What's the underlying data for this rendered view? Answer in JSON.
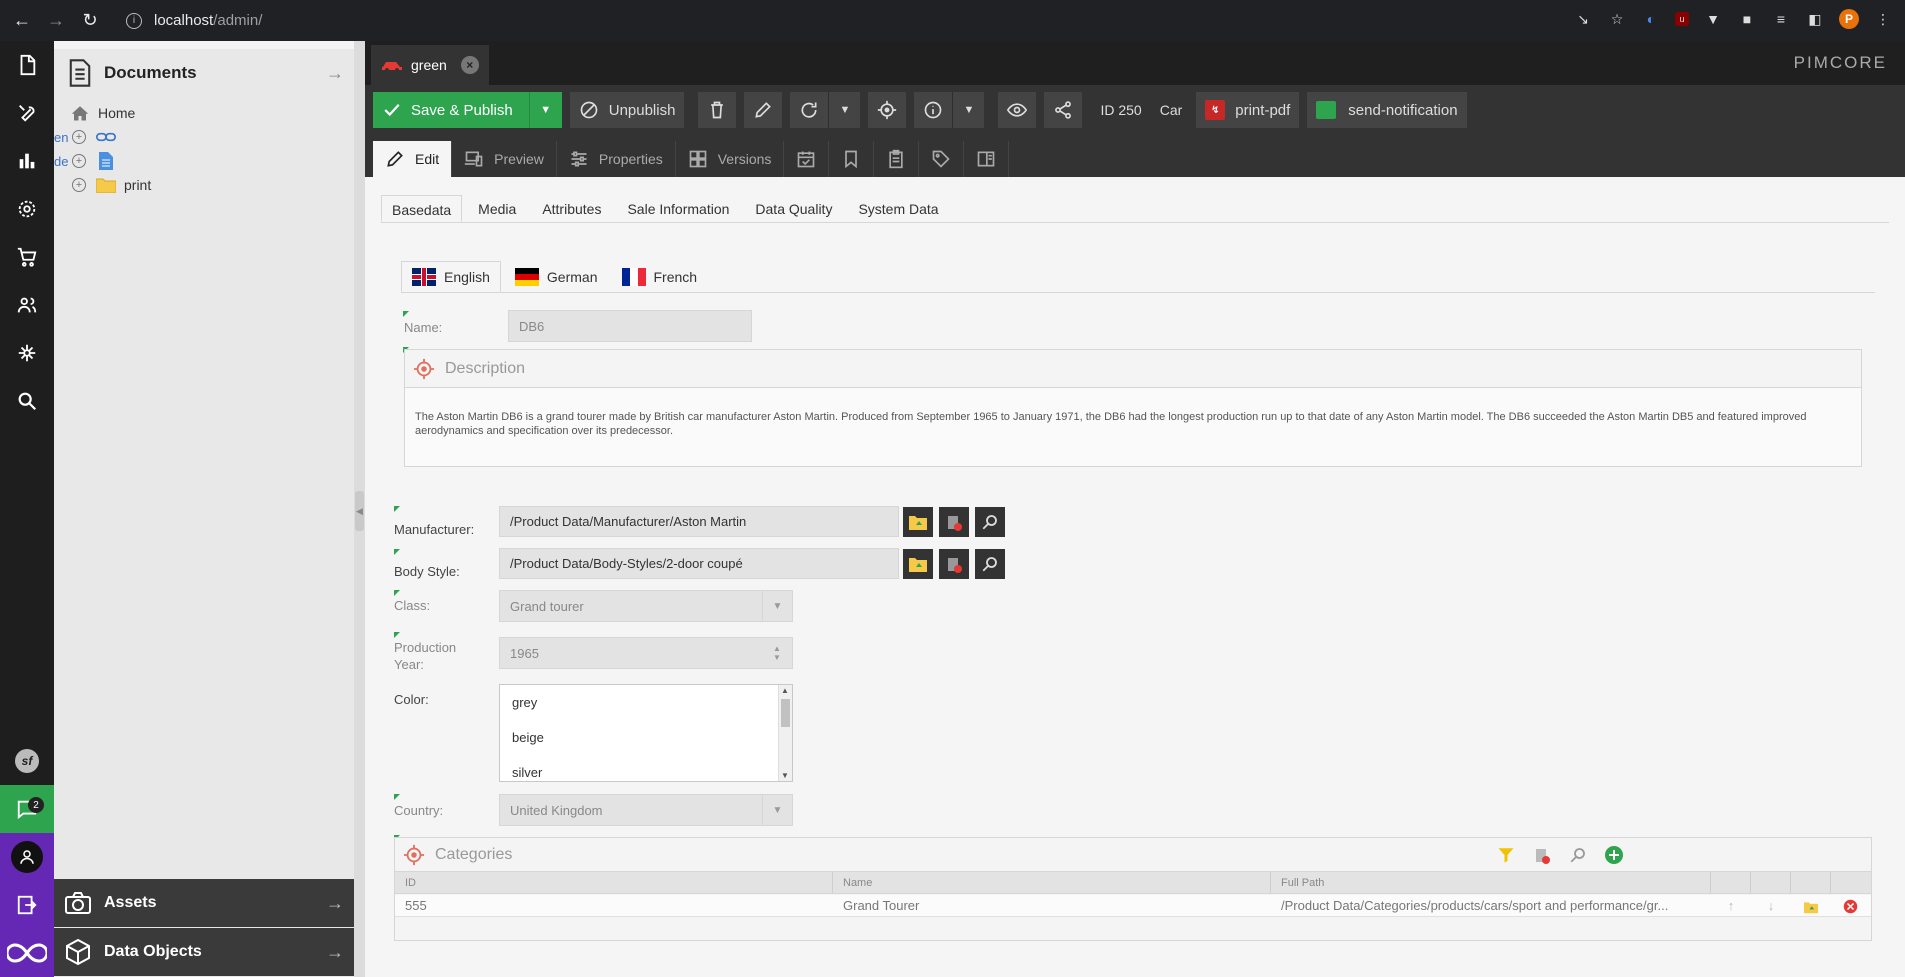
{
  "browser": {
    "url_host": "localhost",
    "url_path": "/admin/",
    "profile_initial": "P"
  },
  "tree": {
    "title": "Documents",
    "items": [
      {
        "label": "Home"
      },
      {
        "label": "en"
      },
      {
        "label": "de"
      },
      {
        "label": "print"
      }
    ],
    "footer_assets": "Assets",
    "footer_objects": "Data Objects"
  },
  "rail": {
    "notification_count": "2"
  },
  "doc_tab": {
    "label": "green"
  },
  "brand": "PIMCORE",
  "toolbar": {
    "save_publish": "Save & Publish",
    "unpublish": "Unpublish",
    "id_label": "ID 250",
    "class_label": "Car",
    "print_pdf": "print-pdf",
    "send_notification": "send-notification"
  },
  "edit_tabs": {
    "edit": "Edit",
    "preview": "Preview",
    "properties": "Properties",
    "versions": "Versions"
  },
  "sub_tabs": [
    "Basedata",
    "Media",
    "Attributes",
    "Sale Information",
    "Data Quality",
    "System Data"
  ],
  "lang_tabs": [
    "English",
    "German",
    "French"
  ],
  "form": {
    "name_label": "Name:",
    "name_value": "DB6",
    "description_title": "Description",
    "description_text": "The Aston Martin DB6 is a grand tourer made by British car manufacturer Aston Martin. Produced from September 1965 to January 1971, the DB6 had the longest production run up to that date of any Aston Martin model. The DB6 succeeded the Aston Martin DB5 and featured improved aerodynamics and specification over its predecessor.",
    "manufacturer_label": "Manufacturer:",
    "manufacturer_value": "/Product Data/Manufacturer/Aston Martin",
    "body_style_label": "Body Style:",
    "body_style_value": "/Product Data/Body-Styles/2-door coupé",
    "class_label": "Class:",
    "class_value": "Grand tourer",
    "production_year_label_1": "Production",
    "production_year_label_2": "Year:",
    "production_year_value": "1965",
    "color_label": "Color:",
    "color_options": [
      "grey",
      "beige",
      "silver"
    ],
    "country_label": "Country:",
    "country_value": "United Kingdom"
  },
  "categories": {
    "title": "Categories",
    "columns": [
      "ID",
      "Name",
      "Full Path"
    ],
    "rows": [
      {
        "id": "555",
        "name": "Grand Tourer",
        "path": "/Product Data/Categories/products/cars/sport and performance/gr..."
      }
    ]
  }
}
